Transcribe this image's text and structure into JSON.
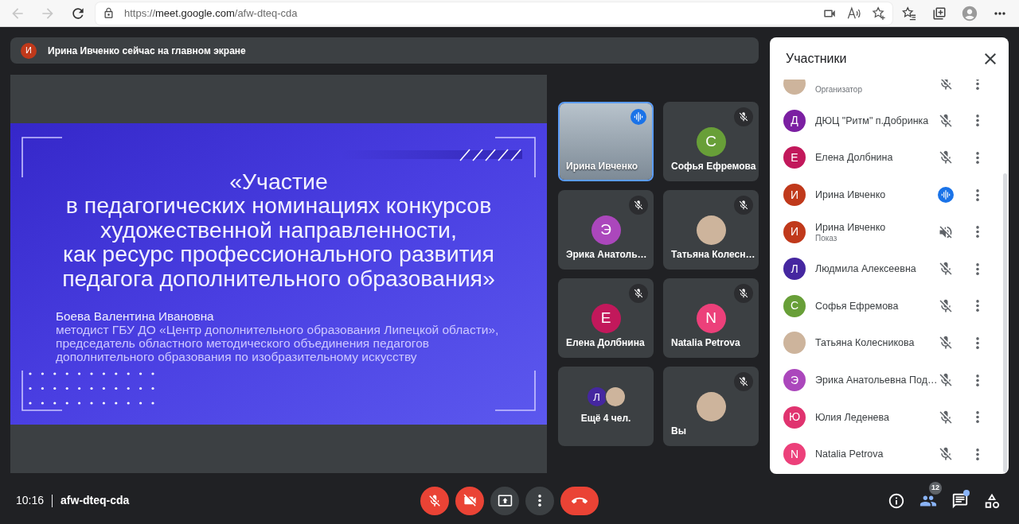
{
  "browser": {
    "nav": [
      {
        "kind": "back",
        "disabled": true
      },
      {
        "kind": "forward",
        "disabled": true
      },
      {
        "kind": "reload",
        "disabled": false
      }
    ],
    "url": {
      "scheme": "https://",
      "host": "meet.google.com",
      "path": "/afw-dteq-cda"
    }
  },
  "banner": {
    "avatar": {
      "kind": "initial",
      "initial": "И",
      "color": "#c0391b"
    },
    "text": "Ирина Ивченко сейчас на главном экране"
  },
  "presentation": {
    "slide": {
      "title": "«Участие\nв педагогических номинациях конкурсов\nхудожественной направленности,\nкак ресурс профессионального развития\nпедагога дополнительного образования»",
      "author": "Боева Валентина Ивановна",
      "position": "методист ГБУ ДО «Центр дополнительного образования Липецкой области»,\nпредседатель областного методического объединения педагогов\nдополнительного образования по изобразительному искусству"
    }
  },
  "tiles": [
    {
      "kind": "video",
      "name": "Ирина Ивченко",
      "muted": false,
      "speaking": true
    },
    {
      "kind": "avatar",
      "name": "Софья Ефремова",
      "muted": true,
      "speaking": false,
      "avatar": {
        "kind": "initial",
        "initial": "С",
        "color": "#689f38"
      }
    },
    {
      "kind": "avatar",
      "name": "Эрика Анатоль…",
      "muted": true,
      "speaking": false,
      "avatar": {
        "kind": "initial",
        "initial": "Э",
        "color": "#ab47bc"
      }
    },
    {
      "kind": "avatar",
      "name": "Татьяна Колесн…",
      "muted": true,
      "speaking": false,
      "avatar": {
        "kind": "photo"
      }
    },
    {
      "kind": "avatar",
      "name": "Елена Долбнина",
      "muted": true,
      "speaking": false,
      "avatar": {
        "kind": "initial",
        "initial": "Е",
        "color": "#c2185b"
      }
    },
    {
      "kind": "avatar",
      "name": "Natalia Petrova",
      "muted": true,
      "speaking": false,
      "avatar": {
        "kind": "initial",
        "initial": "N",
        "color": "#ec407a"
      }
    },
    {
      "kind": "more",
      "label": "Ещё 4 чел.",
      "muted": false,
      "speaking": false,
      "avatars": [
        {
          "kind": "initial",
          "initial": "Л",
          "color": "#4527a0"
        },
        {
          "kind": "photo"
        }
      ]
    },
    {
      "kind": "avatar",
      "name": "Вы",
      "muted": true,
      "speaking": false,
      "avatar": {
        "kind": "photo"
      }
    }
  ],
  "participants": {
    "title": "Участники",
    "items": [
      {
        "kind": "person",
        "subtitle": "Организатор",
        "avatar": {
          "kind": "photo"
        },
        "muted": true,
        "speaking": false
      },
      {
        "kind": "person",
        "name": "ДЮЦ \"Ритм\" п.Добринка",
        "avatar": {
          "kind": "initial",
          "initial": "Д",
          "color": "#7b1fa2"
        },
        "muted": true,
        "speaking": false
      },
      {
        "kind": "person",
        "name": "Елена Долбнина",
        "avatar": {
          "kind": "initial",
          "initial": "Е",
          "color": "#c2185b"
        },
        "muted": true,
        "speaking": false
      },
      {
        "kind": "person",
        "name": "Ирина Ивченко",
        "avatar": {
          "kind": "initial",
          "initial": "И",
          "color": "#c0391b"
        },
        "muted": false,
        "speaking": true
      },
      {
        "kind": "presentation",
        "name": "Ирина Ивченко",
        "subtitle": "Показ",
        "avatar": {
          "kind": "initial",
          "initial": "И",
          "color": "#c0391b"
        },
        "muted": true,
        "speaking": false
      },
      {
        "kind": "person",
        "name": "Людмила Алексеевна",
        "avatar": {
          "kind": "initial",
          "initial": "Л",
          "color": "#4527a0"
        },
        "muted": true,
        "speaking": false
      },
      {
        "kind": "person",
        "name": "Софья Ефремова",
        "avatar": {
          "kind": "initial",
          "initial": "С",
          "color": "#689f38"
        },
        "muted": true,
        "speaking": false
      },
      {
        "kind": "person",
        "name": "Татьяна Колесникова",
        "avatar": {
          "kind": "photo"
        },
        "muted": true,
        "speaking": false
      },
      {
        "kind": "person",
        "name": "Эрика Анатольевна Под…",
        "avatar": {
          "kind": "initial",
          "initial": "Э",
          "color": "#ab47bc"
        },
        "muted": true,
        "speaking": false
      },
      {
        "kind": "person",
        "name": "Юлия Леденева",
        "avatar": {
          "kind": "initial",
          "initial": "Ю",
          "color": "#e0336f"
        },
        "muted": true,
        "speaking": false
      },
      {
        "kind": "person",
        "name": "Natalia Petrova",
        "avatar": {
          "kind": "initial",
          "initial": "N",
          "color": "#ec407a"
        },
        "muted": true,
        "speaking": false
      }
    ]
  },
  "meeting": {
    "time": "10:16",
    "code": "afw-dteq-cda"
  },
  "controls": [
    {
      "kind": "mic",
      "on": false
    },
    {
      "kind": "camera",
      "on": false
    },
    {
      "kind": "present"
    },
    {
      "kind": "more"
    },
    {
      "kind": "end_call"
    }
  ],
  "side_controls": [
    {
      "kind": "info",
      "selected": false,
      "dot": false
    },
    {
      "kind": "people",
      "selected": true,
      "dot": false,
      "badge": "12"
    },
    {
      "kind": "chat",
      "selected": false,
      "dot": true
    },
    {
      "kind": "activities",
      "selected": false,
      "dot": false
    }
  ]
}
